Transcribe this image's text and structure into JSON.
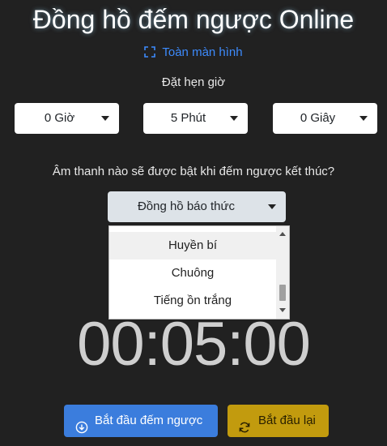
{
  "header": {
    "title": "Đồng hồ đếm ngược Online",
    "fullscreen_label": "Toàn màn hình"
  },
  "timer_setup": {
    "label": "Đặt hẹn giờ",
    "hours": "0 Giờ",
    "minutes": "5 Phút",
    "seconds": "0 Giây"
  },
  "sound": {
    "question": "Âm thanh nào sẽ được bật khi đếm ngược kết thúc?",
    "selected": "Đồng hồ báo thức",
    "options": [
      "Huyền bí",
      "Chuông",
      "Tiếng ồn trắng"
    ]
  },
  "display": {
    "time": "00:05:00"
  },
  "buttons": {
    "start_label": "Bắt đầu đếm ngược",
    "reset_label": "Bắt đầu lại"
  },
  "colors": {
    "background": "#212121",
    "accent_blue": "#3b7ddd",
    "accent_gold": "#c29b0e",
    "link": "#3d8bfd"
  },
  "icons": {
    "fullscreen": "fullscreen-icon",
    "start": "arrow-down-circle-icon",
    "reset": "refresh-icon"
  }
}
